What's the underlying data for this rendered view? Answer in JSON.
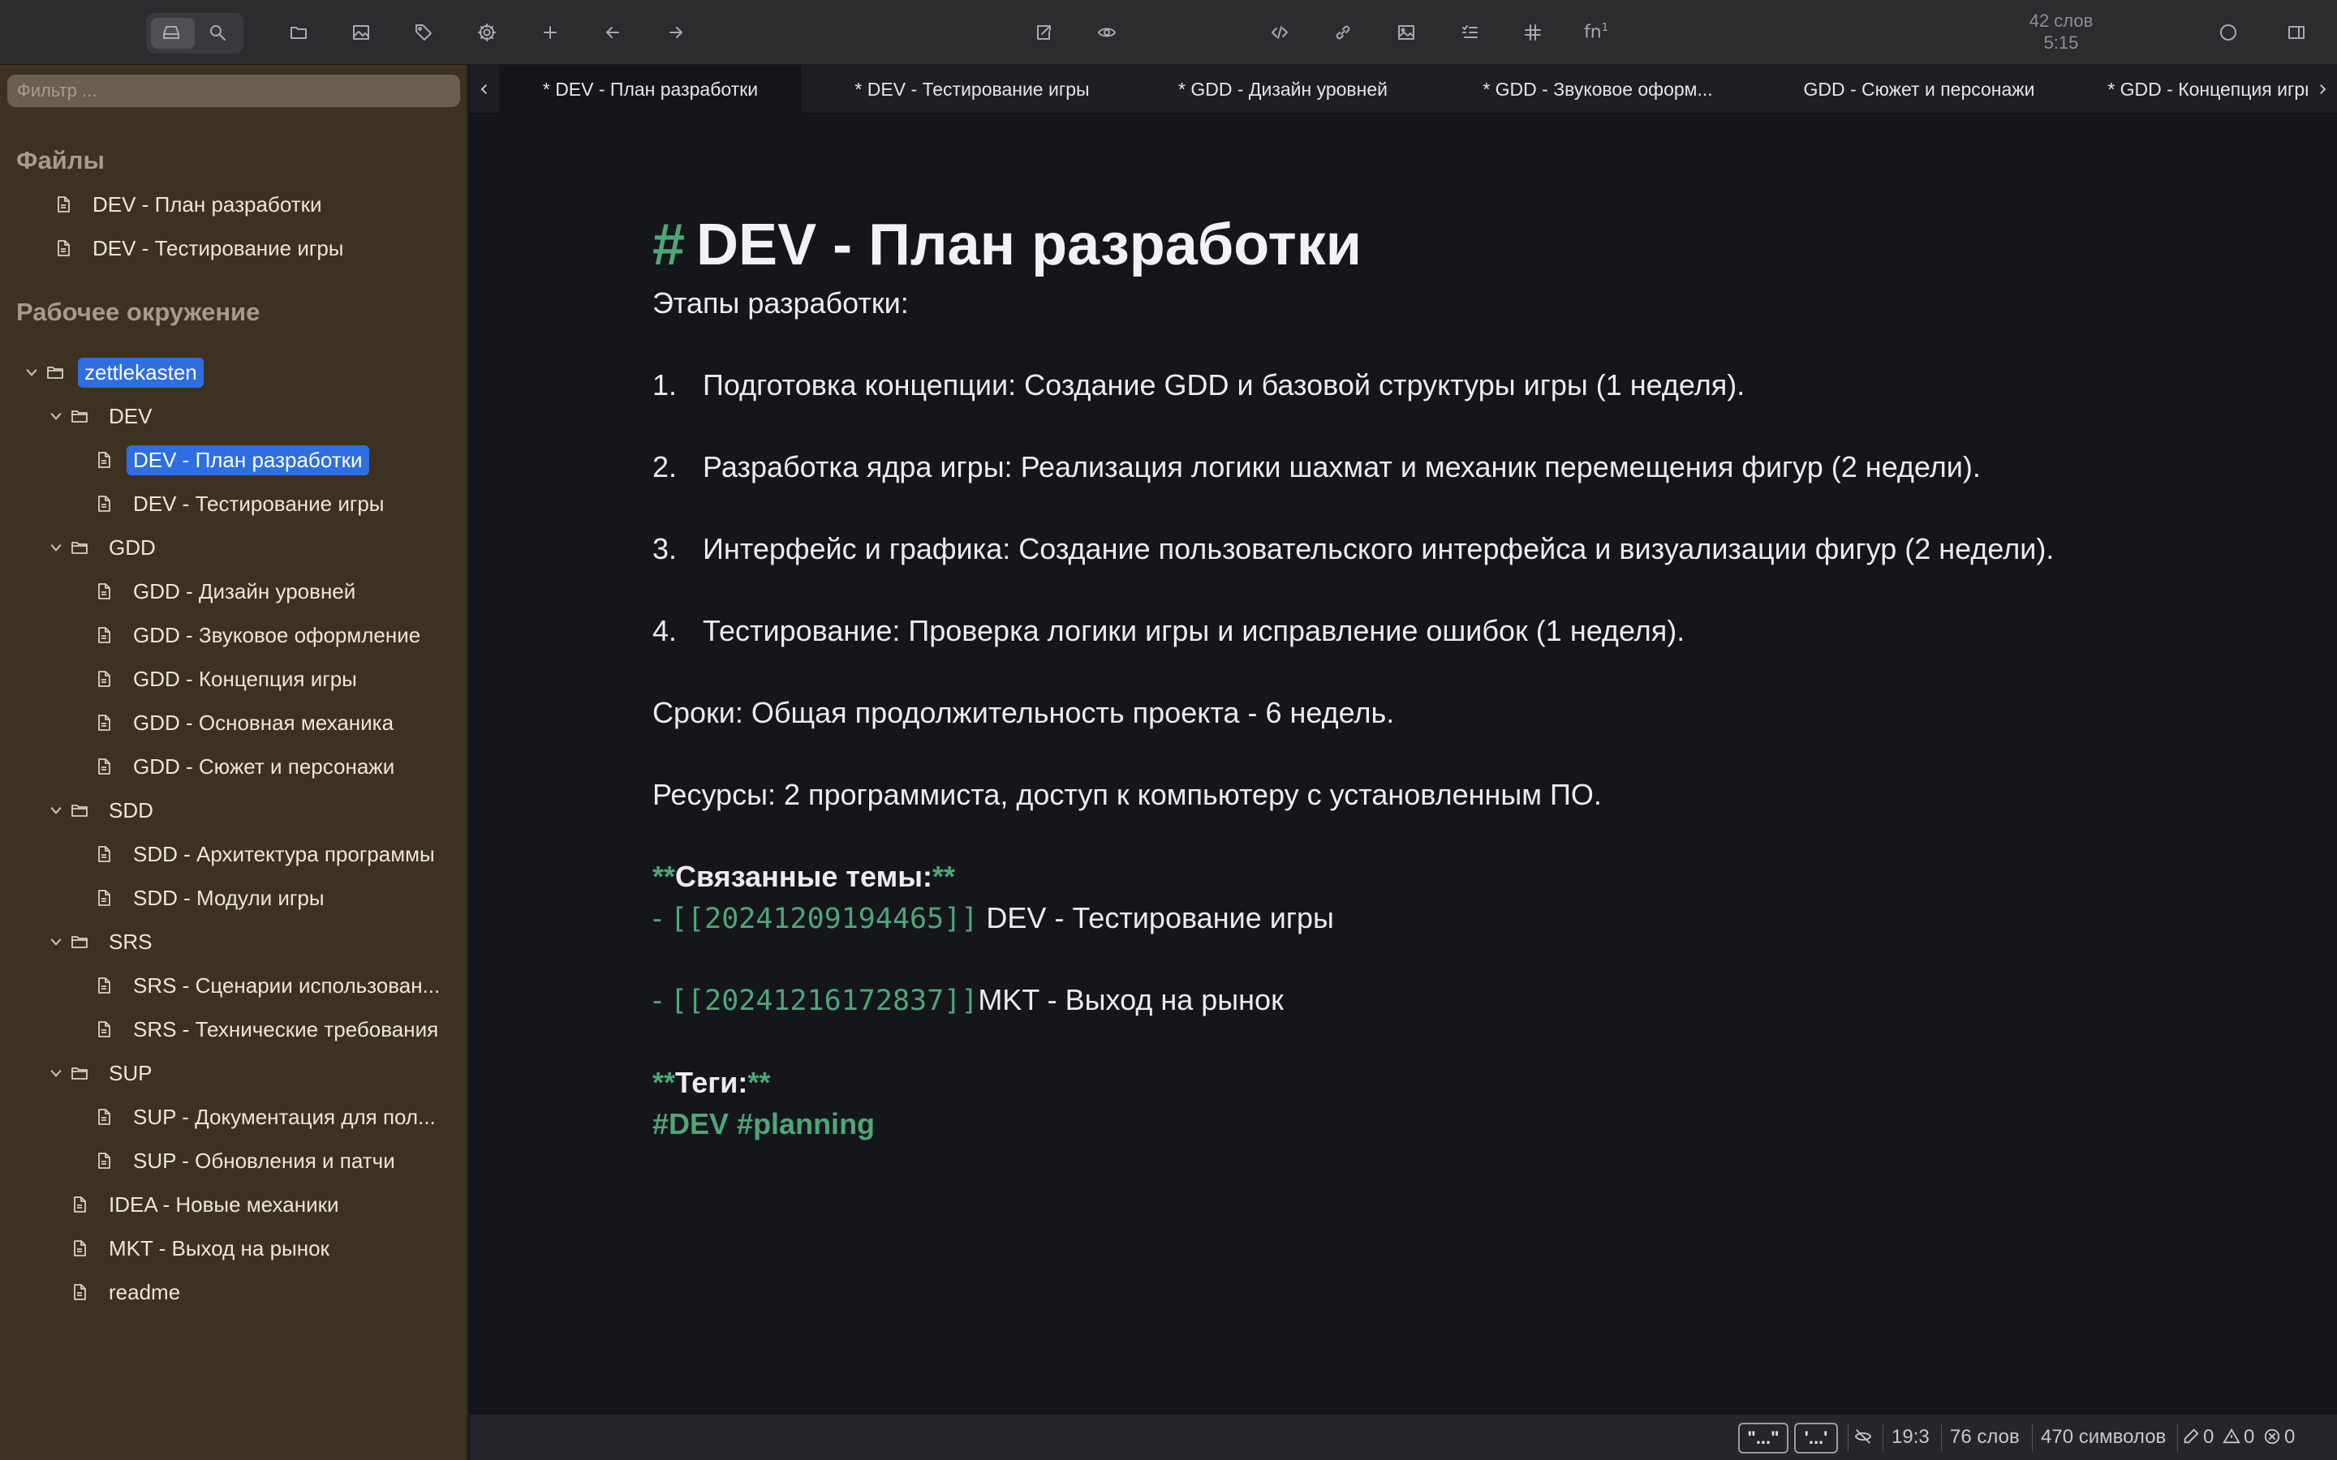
{
  "toolbar": {
    "icons": [
      "drive-icon",
      "search-icon",
      "folder-icon",
      "image-icon",
      "tag-icon",
      "gear-icon",
      "plus-icon",
      "arrow-left-icon",
      "arrow-right-icon",
      "export-icon",
      "eye-icon",
      "code-icon",
      "link-icon",
      "image-icon",
      "list-icon",
      "table-icon",
      "footnote-icon",
      "circle-icon",
      "sidebar-toggle-icon"
    ],
    "word_count": "42 слов",
    "reading_time": "5:15",
    "footnote_label": "fn",
    "footnote_sup": "1"
  },
  "sidebar": {
    "filter_placeholder": "Фильтр ...",
    "files_title": "Файлы",
    "files": [
      {
        "label": "DEV - План разработки"
      },
      {
        "label": "DEV - Тестирование игры"
      }
    ],
    "workspace_title": "Рабочее окружение",
    "tree": [
      {
        "label": "zettlekasten",
        "type": "folder",
        "expanded": true,
        "selected_folder": true
      },
      {
        "label": "DEV",
        "type": "folder",
        "expanded": true
      },
      {
        "label": "DEV - План разработки",
        "type": "file",
        "selected": true
      },
      {
        "label": "DEV - Тестирование игры",
        "type": "file"
      },
      {
        "label": "GDD",
        "type": "folder",
        "expanded": true
      },
      {
        "label": "GDD - Дизайн уровней",
        "type": "file"
      },
      {
        "label": "GDD - Звуковое оформление",
        "type": "file"
      },
      {
        "label": "GDD - Концепция игры",
        "type": "file"
      },
      {
        "label": "GDD - Основная механика",
        "type": "file"
      },
      {
        "label": "GDD - Сюжет и персонажи",
        "type": "file"
      },
      {
        "label": "SDD",
        "type": "folder",
        "expanded": true
      },
      {
        "label": "SDD - Архитектура программы",
        "type": "file"
      },
      {
        "label": "SDD - Модули игры",
        "type": "file"
      },
      {
        "label": "SRS",
        "type": "folder",
        "expanded": true
      },
      {
        "label": "SRS - Сценарии использован...",
        "type": "file"
      },
      {
        "label": "SRS - Технические требования",
        "type": "file"
      },
      {
        "label": "SUP",
        "type": "folder",
        "expanded": true
      },
      {
        "label": "SUP - Документация для пол...",
        "type": "file"
      },
      {
        "label": "SUP - Обновления и патчи",
        "type": "file"
      },
      {
        "label": "IDEA - Новые механики",
        "type": "file"
      },
      {
        "label": "MKT - Выход на рынок",
        "type": "file"
      },
      {
        "label": "readme",
        "type": "file"
      }
    ]
  },
  "tabs": [
    {
      "label": "* DEV - План разработки",
      "active": true
    },
    {
      "label": "* DEV - Тестирование игры"
    },
    {
      "label": "* GDD - Дизайн уровней"
    },
    {
      "label": "* GDD - Звуковое оформ..."
    },
    {
      "label": "GDD - Сюжет и персонажи"
    },
    {
      "label": "* GDD - Концепция игры"
    }
  ],
  "document": {
    "title_hash": "#",
    "title": "DEV - План разработки",
    "intro": "Этапы разработки:",
    "items": [
      {
        "num": "1.",
        "text": "Подготовка концепции: Создание GDD и базовой структуры игры (1 неделя)."
      },
      {
        "num": "2.",
        "text": "Разработка ядра игры: Реализация логики шахмат и механик перемещения фигур (2 недели)."
      },
      {
        "num": "3.",
        "text": "Интерфейс и графика: Создание пользовательского интерфейса и визуализации фигур (2 недели)."
      },
      {
        "num": "4.",
        "text": "Тестирование: Проверка логики игры и исправление ошибок (1 неделя)."
      }
    ],
    "deadline": "Сроки: Общая продолжительность проекта - 6 недель.",
    "resources": "Ресурсы: 2 программиста, доступ к компьютеру с установленным ПО.",
    "bold_mark": "**",
    "related_title": "Связанные темы:",
    "links": [
      {
        "dash": "-",
        "ref": "[[20241209194465]]",
        "text": " DEV - Тестирование игры"
      },
      {
        "dash": "-",
        "ref": "[[20241216172837]]",
        "text": "MKT - Выход на рынок"
      }
    ],
    "tags_title": "Теги:",
    "tags": "#DEV #planning"
  },
  "statusbar": {
    "quotes_double": "\"...\"",
    "quotes_single": "'...'",
    "cursor": "19:3",
    "words": "76 слов",
    "chars": "470 символов",
    "info_count": "0",
    "warn_count": "0",
    "error_count": "0"
  },
  "colors": {
    "accent": "#2e6ee0",
    "markdown_green": "#4fa676",
    "sidebar_bg": "#3d3221",
    "editor_bg": "#15161c"
  }
}
